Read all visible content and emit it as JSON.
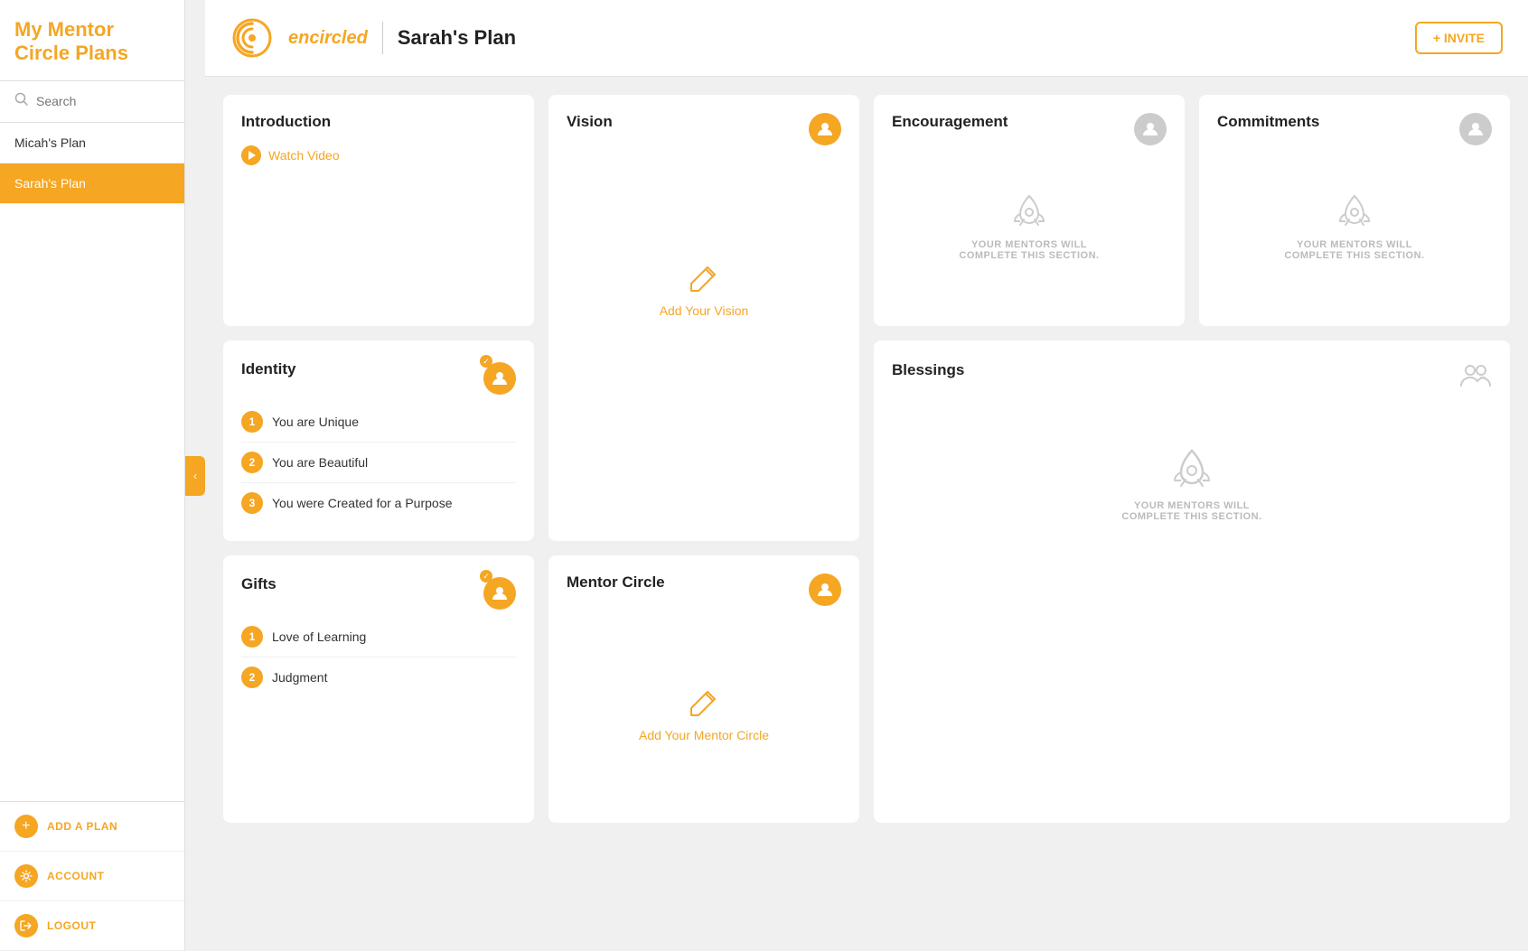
{
  "sidebar": {
    "title": "My Mentor\nCircle Plans",
    "search_placeholder": "Search",
    "plans": [
      {
        "label": "Micah's Plan",
        "active": false
      },
      {
        "label": "Sarah's Plan",
        "active": true
      }
    ],
    "actions": [
      {
        "key": "add-plan",
        "label": "ADD A PLAN",
        "icon": "+"
      },
      {
        "key": "account",
        "label": "ACCOUNT",
        "icon": "gear"
      },
      {
        "key": "logout",
        "label": "LOGOUT",
        "icon": "logout"
      }
    ]
  },
  "header": {
    "logo_alt": "encircled",
    "plan_title": "Sarah's Plan",
    "invite_label": "+ INVITE"
  },
  "cards": {
    "introduction": {
      "title": "Introduction",
      "watch_video": "Watch Video"
    },
    "identity": {
      "title": "Identity",
      "items": [
        {
          "number": "1",
          "label": "You are Unique"
        },
        {
          "number": "2",
          "label": "You are Beautiful"
        },
        {
          "number": "3",
          "label": "You were Created for a Purpose"
        }
      ]
    },
    "vision": {
      "title": "Vision",
      "add_label": "Add Your Vision"
    },
    "encouragement": {
      "title": "Encouragement",
      "mentor_text": "YOUR MENTORS WILL\nCOMPLETE THIS SECTION."
    },
    "commitments": {
      "title": "Commitments",
      "mentor_text": "YOUR MENTORS WILL\nCOMPLETE THIS SECTION."
    },
    "gifts": {
      "title": "Gifts",
      "items": [
        {
          "number": "1",
          "label": "Love of Learning"
        },
        {
          "number": "2",
          "label": "Judgment"
        }
      ]
    },
    "mentor_circle": {
      "title": "Mentor Circle",
      "add_label": "Add Your Mentor Circle"
    },
    "blessings": {
      "title": "Blessings",
      "mentor_text": "YOUR MENTORS WILL\nCOMPLETE THIS SECTION."
    }
  },
  "colors": {
    "orange": "#f5a623",
    "gray_avatar": "#ccc",
    "text_dark": "#222",
    "text_light": "#bbb"
  }
}
